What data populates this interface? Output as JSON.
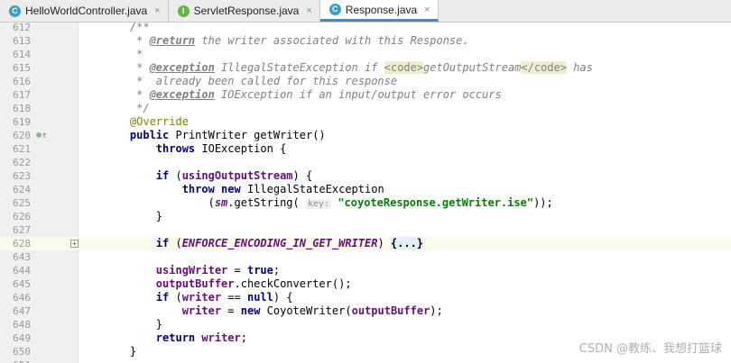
{
  "tabs": [
    {
      "label": "HelloWorldController.java",
      "icon": "C",
      "kind": "class",
      "active": false
    },
    {
      "label": "ServletResponse.java",
      "icon": "I",
      "kind": "interface",
      "active": false
    },
    {
      "label": "Response.java",
      "icon": "C",
      "kind": "class",
      "active": true
    }
  ],
  "tab_close_glyph": "×",
  "lines": [
    {
      "n": "612",
      "tokens": [
        [
          "cm",
          "    /**"
        ]
      ]
    },
    {
      "n": "613",
      "tokens": [
        [
          "cm",
          "     * "
        ],
        [
          "tg",
          "@return"
        ],
        [
          "cm",
          " the writer associated with this Response."
        ]
      ]
    },
    {
      "n": "614",
      "tokens": [
        [
          "cm",
          "     *"
        ]
      ]
    },
    {
      "n": "615",
      "tokens": [
        [
          "cm",
          "     * "
        ],
        [
          "tg",
          "@exception"
        ],
        [
          "cm",
          " IllegalStateException if "
        ],
        [
          "ht",
          "<code>"
        ],
        [
          "cm",
          "getOutputStream"
        ],
        [
          "ht",
          "</code>"
        ],
        [
          "cm",
          " has"
        ]
      ]
    },
    {
      "n": "616",
      "tokens": [
        [
          "cm",
          "     *  already been called for this response"
        ]
      ]
    },
    {
      "n": "617",
      "tokens": [
        [
          "cm",
          "     * "
        ],
        [
          "tg",
          "@exception"
        ],
        [
          "cm",
          " IOException if an input/output error occurs"
        ]
      ]
    },
    {
      "n": "618",
      "tokens": [
        [
          "cm",
          "     */"
        ]
      ]
    },
    {
      "n": "619",
      "tokens": [
        [
          "an",
          "    @Override"
        ]
      ]
    },
    {
      "n": "620",
      "tokens": [
        [
          "",
          "    "
        ],
        [
          "kw",
          "public"
        ],
        [
          "",
          " PrintWriter getWriter()"
        ]
      ],
      "marker": "⊕↑"
    },
    {
      "n": "621",
      "tokens": [
        [
          "",
          "        "
        ],
        [
          "kw",
          "throws"
        ],
        [
          "",
          " IOException {"
        ]
      ]
    },
    {
      "n": "622",
      "tokens": []
    },
    {
      "n": "623",
      "tokens": [
        [
          "",
          "        "
        ],
        [
          "kw",
          "if"
        ],
        [
          "",
          " ("
        ],
        [
          "fd",
          "usingOutputStream"
        ],
        [
          "",
          ") {"
        ]
      ]
    },
    {
      "n": "624",
      "tokens": [
        [
          "",
          "            "
        ],
        [
          "kw",
          "throw new"
        ],
        [
          "",
          " IllegalStateException"
        ]
      ]
    },
    {
      "n": "625",
      "tokens": [
        [
          "",
          "                ("
        ],
        [
          "sf",
          "sm"
        ],
        [
          "",
          ".getString( "
        ],
        [
          "ph",
          "key:"
        ],
        [
          "",
          " "
        ],
        [
          "st",
          "\"coyoteResponse.getWriter.ise\""
        ],
        [
          "",
          "));"
        ]
      ]
    },
    {
      "n": "626",
      "tokens": [
        [
          "",
          "        }"
        ]
      ]
    },
    {
      "n": "627",
      "tokens": []
    },
    {
      "n": "628",
      "tokens": [
        [
          "",
          "        "
        ],
        [
          "kw",
          "if"
        ],
        [
          "",
          " ("
        ],
        [
          "sf",
          "ENFORCE_ENCODING_IN_GET_WRITER"
        ],
        [
          "",
          ") "
        ],
        [
          "fold",
          "{...}"
        ]
      ],
      "highlight": true,
      "fold": true
    },
    {
      "n": "643",
      "tokens": []
    },
    {
      "n": "644",
      "tokens": [
        [
          "",
          "        "
        ],
        [
          "fd",
          "usingWriter"
        ],
        [
          "",
          " = "
        ],
        [
          "kw",
          "true"
        ],
        [
          "",
          ";"
        ]
      ]
    },
    {
      "n": "645",
      "tokens": [
        [
          "",
          "        "
        ],
        [
          "fd",
          "outputBuffer"
        ],
        [
          "",
          ".checkConverter();"
        ]
      ]
    },
    {
      "n": "646",
      "tokens": [
        [
          "",
          "        "
        ],
        [
          "kw",
          "if"
        ],
        [
          "",
          " ("
        ],
        [
          "fd",
          "writer"
        ],
        [
          "",
          " == "
        ],
        [
          "kw",
          "null"
        ],
        [
          "",
          ") {"
        ]
      ]
    },
    {
      "n": "647",
      "tokens": [
        [
          "",
          "            "
        ],
        [
          "fd",
          "writer"
        ],
        [
          "",
          " = "
        ],
        [
          "kw",
          "new"
        ],
        [
          "",
          " CoyoteWriter("
        ],
        [
          "fd",
          "outputBuffer"
        ],
        [
          "",
          ");"
        ]
      ]
    },
    {
      "n": "648",
      "tokens": [
        [
          "",
          "        }"
        ]
      ]
    },
    {
      "n": "649",
      "tokens": [
        [
          "",
          "        "
        ],
        [
          "kw",
          "return"
        ],
        [
          "",
          " "
        ],
        [
          "fd",
          "writer"
        ],
        [
          "",
          ";"
        ]
      ]
    },
    {
      "n": "650",
      "tokens": [
        [
          "",
          "    }"
        ]
      ]
    },
    {
      "n": "651",
      "tokens": []
    }
  ],
  "watermark": "CSDN @教练、我想打篮球"
}
